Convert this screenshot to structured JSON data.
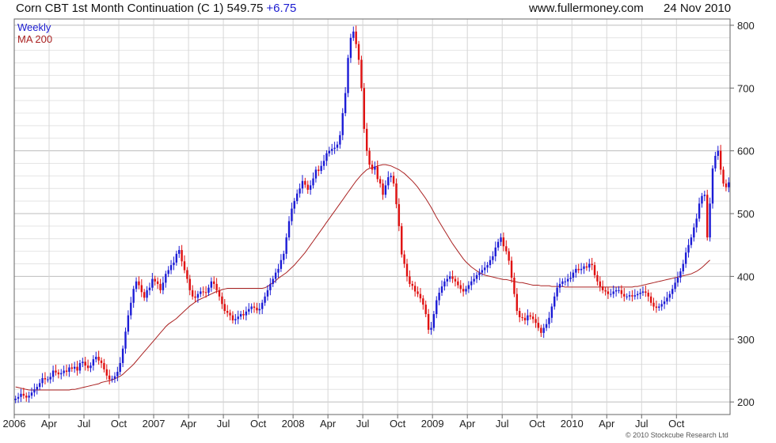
{
  "header": {
    "title": "Corn CBT 1st Month Continuation (C 1) 549.75",
    "change": "+6.75",
    "source": "www.fullermoney.com",
    "date": "24 Nov 2010"
  },
  "legend": {
    "weekly": "Weekly",
    "ma": "MA 200"
  },
  "copyright": "© 2010 Stockcube Research Ltd",
  "colors": {
    "up": "#1c1cd6",
    "down": "#e01010",
    "ma": "#aa2222",
    "grid": "#d0d0d0",
    "frame": "#666666"
  },
  "chart_data": {
    "type": "candlestick",
    "title": "Corn CBT 1st Month Continuation (C 1) 549.75 +6.75",
    "ylim": [
      180,
      810
    ],
    "y_ticks": [
      "200",
      "300",
      "400",
      "500",
      "600",
      "700",
      "800"
    ],
    "grid": true,
    "legend_position": "top-left",
    "x_labels": [
      {
        "label": "2006",
        "week": 0
      },
      {
        "label": "Apr",
        "week": 13
      },
      {
        "label": "Jul",
        "week": 26
      },
      {
        "label": "Oct",
        "week": 39
      },
      {
        "label": "2007",
        "week": 52
      },
      {
        "label": "Apr",
        "week": 65
      },
      {
        "label": "Jul",
        "week": 78
      },
      {
        "label": "Oct",
        "week": 91
      },
      {
        "label": "2008",
        "week": 104
      },
      {
        "label": "Apr",
        "week": 117
      },
      {
        "label": "Jul",
        "week": 130
      },
      {
        "label": "Oct",
        "week": 143
      },
      {
        "label": "2009",
        "week": 156
      },
      {
        "label": "Apr",
        "week": 169
      },
      {
        "label": "Jul",
        "week": 182
      },
      {
        "label": "Oct",
        "week": 195
      },
      {
        "label": "2010",
        "week": 208
      },
      {
        "label": "Apr",
        "week": 221
      },
      {
        "label": "Jul",
        "week": 234
      },
      {
        "label": "Oct",
        "week": 247
      }
    ],
    "series": [
      {
        "name": "Weekly",
        "kind": "ohlc"
      },
      {
        "name": "MA 200",
        "kind": "line"
      }
    ],
    "weekly_close": [
      205,
      208,
      213,
      210,
      207,
      210,
      215,
      220,
      224,
      230,
      238,
      236,
      236,
      240,
      250,
      247,
      244,
      246,
      250,
      248,
      255,
      253,
      256,
      250,
      262,
      264,
      258,
      254,
      258,
      268,
      272,
      266,
      262,
      252,
      242,
      236,
      237,
      241,
      248,
      262,
      285,
      312,
      338,
      358,
      380,
      392,
      386,
      375,
      366,
      378,
      382,
      396,
      392,
      388,
      378,
      390,
      404,
      410,
      418,
      422,
      436,
      442,
      424,
      410,
      396,
      378,
      368,
      366,
      372,
      376,
      375,
      374,
      382,
      392,
      388,
      378,
      368,
      356,
      345,
      342,
      338,
      330,
      332,
      336,
      340,
      338,
      344,
      348,
      352,
      350,
      346,
      348,
      358,
      368,
      378,
      388,
      396,
      406,
      412,
      426,
      436,
      462,
      488,
      508,
      520,
      532,
      540,
      552,
      546,
      538,
      545,
      556,
      570,
      568,
      576,
      584,
      596,
      600,
      603,
      605,
      610,
      625,
      660,
      692,
      748,
      780,
      790,
      770,
      745,
      700,
      635,
      600,
      578,
      570,
      575,
      555,
      548,
      530,
      545,
      558,
      560,
      548,
      515,
      480,
      435,
      420,
      400,
      388,
      385,
      376,
      372,
      365,
      355,
      340,
      315,
      318,
      340,
      362,
      374,
      384,
      392,
      396,
      400,
      396,
      392,
      386,
      380,
      376,
      380,
      386,
      392,
      396,
      402,
      406,
      410,
      414,
      418,
      426,
      432,
      446,
      455,
      462,
      448,
      440,
      425,
      398,
      372,
      345,
      335,
      334,
      330,
      338,
      336,
      332,
      326,
      318,
      310,
      318,
      324,
      334,
      352,
      368,
      382,
      388,
      392,
      392,
      396,
      398,
      406,
      412,
      410,
      412,
      416,
      414,
      420,
      418,
      402,
      392,
      384,
      378,
      376,
      372,
      372,
      376,
      378,
      378,
      372,
      368,
      368,
      370,
      368,
      370,
      372,
      374,
      376,
      374,
      368,
      358,
      352,
      350,
      352,
      356,
      360,
      366,
      372,
      380,
      390,
      398,
      408,
      420,
      438,
      450,
      462,
      478,
      492,
      516,
      528,
      530,
      462,
      516,
      572,
      592,
      600,
      570,
      548,
      542,
      549.75
    ],
    "ma200": [
      224,
      223,
      222,
      221,
      220,
      219,
      219,
      219,
      219,
      219,
      219,
      219,
      219,
      219,
      219,
      219,
      219,
      219,
      219,
      219,
      219,
      220,
      220,
      221,
      222,
      223,
      224,
      225,
      226,
      227,
      228,
      229,
      231,
      232,
      233,
      234,
      235,
      237,
      239,
      241,
      244,
      248,
      252,
      256,
      260,
      265,
      270,
      275,
      280,
      285,
      290,
      295,
      300,
      305,
      310,
      315,
      320,
      324,
      327,
      330,
      333,
      337,
      341,
      345,
      349,
      353,
      356,
      359,
      362,
      364,
      366,
      368,
      370,
      372,
      374,
      376,
      377,
      379,
      380,
      381,
      381,
      381,
      381,
      381,
      381,
      381,
      381,
      381,
      381,
      381,
      381,
      381,
      381,
      382,
      384,
      387,
      390,
      393,
      397,
      400,
      403,
      406,
      410,
      414,
      418,
      423,
      428,
      433,
      438,
      444,
      450,
      456,
      462,
      468,
      474,
      480,
      486,
      492,
      498,
      504,
      510,
      516,
      522,
      528,
      534,
      540,
      546,
      552,
      557,
      562,
      566,
      570,
      572,
      573,
      574,
      576,
      577,
      578,
      578,
      577,
      576,
      574,
      572,
      570,
      567,
      564,
      560,
      556,
      552,
      547,
      542,
      536,
      530,
      524,
      517,
      510,
      502,
      494,
      487,
      480,
      473,
      466,
      459,
      452,
      446,
      440,
      434,
      428,
      423,
      419,
      415,
      412,
      409,
      406,
      404,
      402,
      401,
      400,
      399,
      398,
      397,
      396,
      395,
      395,
      394,
      393,
      392,
      391,
      390,
      390,
      389,
      388,
      387,
      386,
      386,
      386,
      385,
      385,
      385,
      385,
      384,
      384,
      384,
      384,
      384,
      383,
      383,
      383,
      383,
      383,
      383,
      383,
      383,
      383,
      383,
      383,
      383,
      383,
      383,
      383,
      383,
      383,
      383,
      383,
      383,
      383,
      383,
      383,
      383,
      383,
      383,
      384,
      384,
      385,
      386,
      387,
      388,
      389,
      390,
      391,
      392,
      393,
      394,
      395,
      396,
      397,
      398,
      399,
      400,
      401,
      402,
      403,
      404,
      406,
      408,
      411,
      414,
      418,
      422,
      426
    ],
    "annotations": []
  }
}
